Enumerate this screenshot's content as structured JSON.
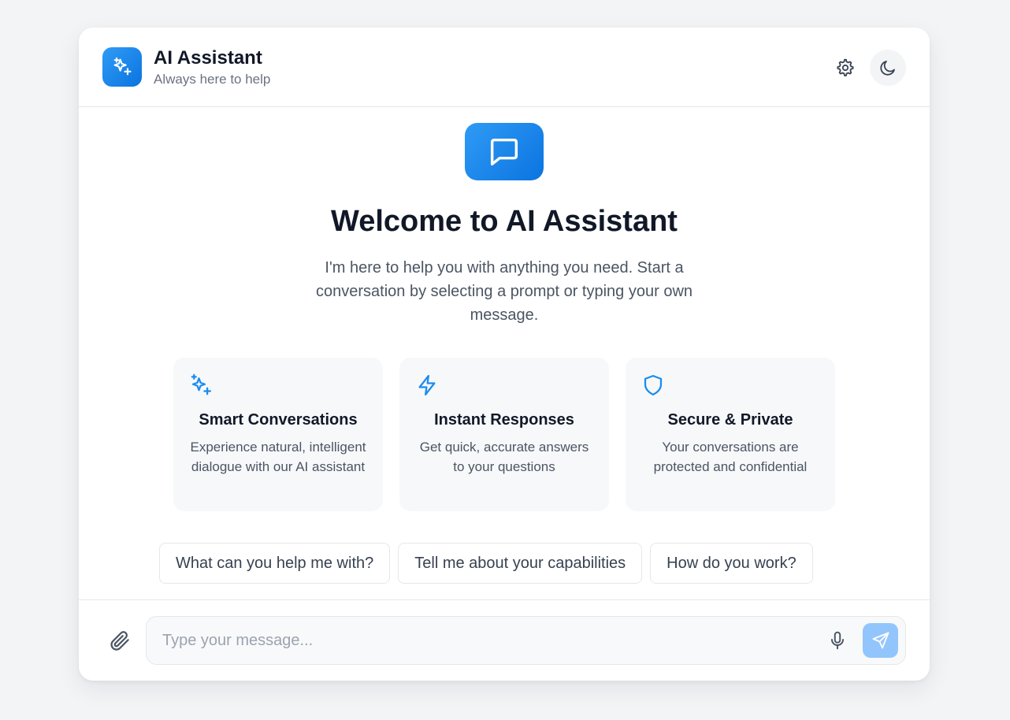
{
  "header": {
    "title": "AI Assistant",
    "subtitle": "Always here to help",
    "logo_icon": "sparkles-icon",
    "settings_icon": "gear-icon",
    "theme_icon": "moon-icon"
  },
  "welcome": {
    "icon": "chat-bubble-icon",
    "title": "Welcome to AI Assistant",
    "description": "I'm here to help you with anything you need. Start a conversation by selecting a prompt or typing your own message."
  },
  "features": [
    {
      "icon": "sparkles-icon",
      "title": "Smart Conversations",
      "description": "Experience natural, intelligent dialogue with our AI assistant"
    },
    {
      "icon": "lightning-icon",
      "title": "Instant Responses",
      "description": "Get quick, accurate answers to your questions"
    },
    {
      "icon": "shield-icon",
      "title": "Secure & Private",
      "description": "Your conversations are protected and confidential"
    }
  ],
  "prompts": [
    "What can you help me with?",
    "Tell me about your capabilities",
    "How do you work?"
  ],
  "composer": {
    "placeholder": "Type your message...",
    "value": "",
    "attach_icon": "paperclip-icon",
    "mic_icon": "microphone-icon",
    "send_icon": "send-icon"
  },
  "colors": {
    "accent": "#1a8cf0",
    "send_disabled": "#93c5fd",
    "background": "#f3f4f6"
  }
}
